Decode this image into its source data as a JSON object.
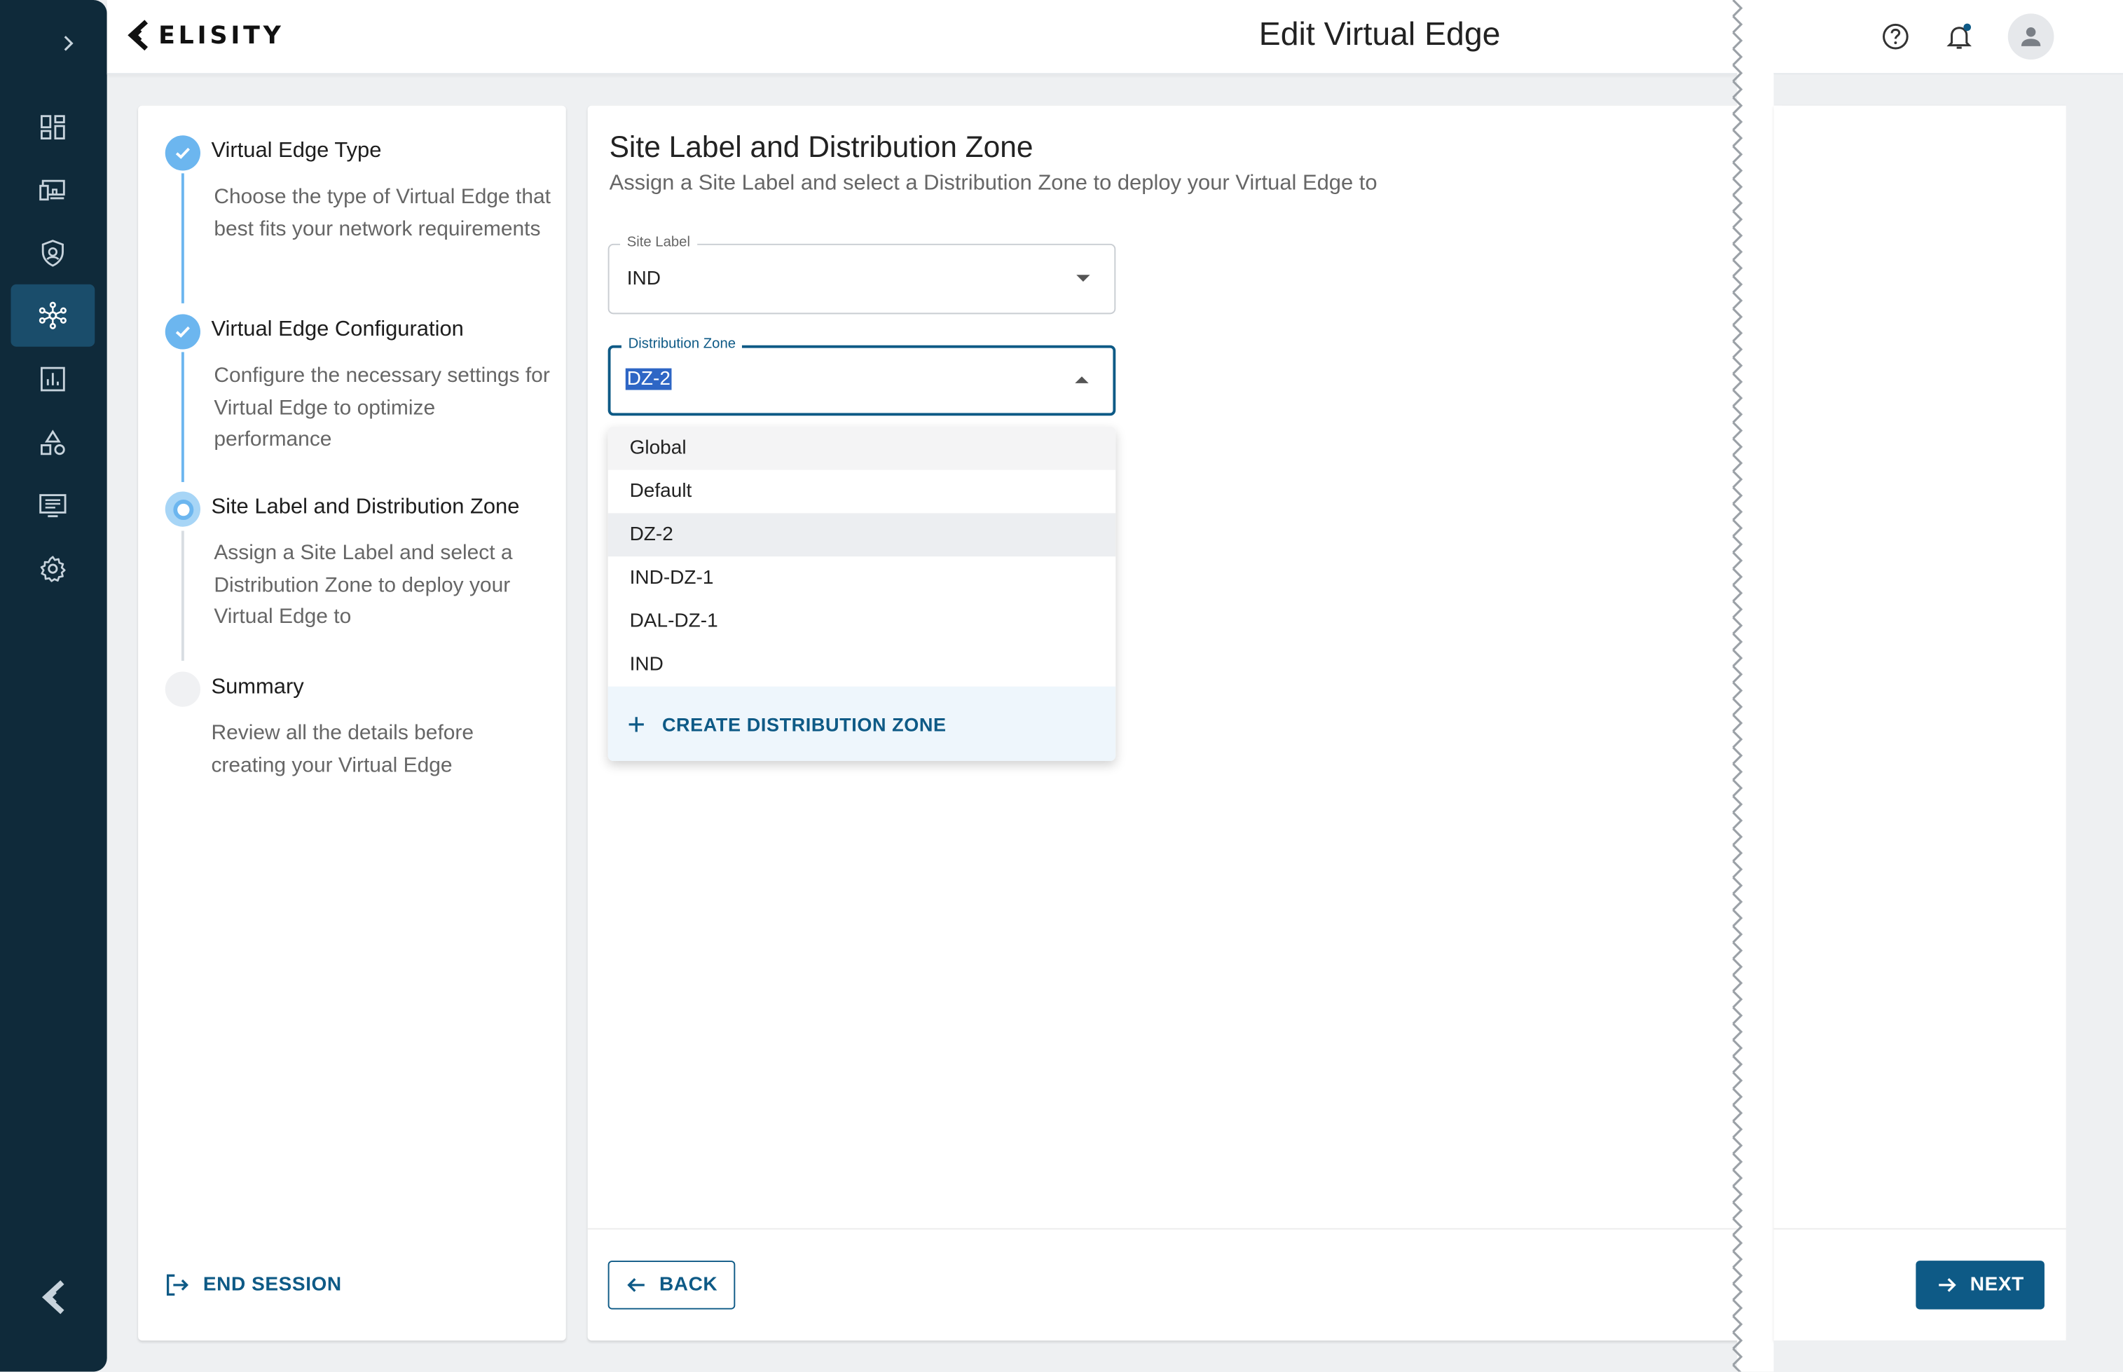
{
  "header": {
    "logo_text": "ELISITY",
    "title": "Edit Virtual Edge",
    "icons": [
      "help-icon",
      "bell-icon",
      "user-avatar-icon"
    ],
    "notification_dot_color": "#0e5a86"
  },
  "nav": {
    "expand_icon": "chevron-right-icon",
    "items": [
      {
        "name": "dashboard-icon",
        "active": false
      },
      {
        "name": "devices-icon",
        "active": false
      },
      {
        "name": "policy-shield-icon",
        "active": false
      },
      {
        "name": "network-icon",
        "active": true
      },
      {
        "name": "analytics-icon",
        "active": false
      },
      {
        "name": "shapes-icon",
        "active": false
      },
      {
        "name": "monitor-list-icon",
        "active": false
      },
      {
        "name": "settings-gear-icon",
        "active": false
      }
    ],
    "bottom_logo": "elisity-mark-icon"
  },
  "stepper": {
    "steps": [
      {
        "title": "Virtual Edge Type",
        "description": "Choose the type of Virtual Edge that best fits your network requirements",
        "state": "done"
      },
      {
        "title": "Virtual Edge Configuration",
        "description": "Configure the necessary settings for Virtual Edge to optimize performance",
        "state": "done"
      },
      {
        "title": "Site Label and Distribution Zone",
        "description": "Assign a Site Label and select a Distribution Zone to deploy your Virtual Edge to",
        "state": "current"
      },
      {
        "title": "Summary",
        "description": "Review all the details before creating your Virtual Edge",
        "state": "todo"
      }
    ],
    "end_session_label": "END SESSION"
  },
  "main": {
    "title": "Site Label and Distribution Zone",
    "subtitle": "Assign a Site Label and select a Distribution Zone to deploy your Virtual Edge to",
    "site_label": {
      "label": "Site Label",
      "value": "IND"
    },
    "distribution_zone": {
      "label": "Distribution Zone",
      "value": "DZ-2"
    },
    "dropdown_options": [
      "Global",
      "Default",
      "DZ-2",
      "IND-DZ-1",
      "DAL-DZ-1",
      "IND"
    ],
    "create_zone_label": "CREATE DISTRIBUTION ZONE",
    "back_label": "BACK",
    "next_label": "NEXT"
  },
  "colors": {
    "primary": "#0e5a86",
    "nav_bg": "#0f2a3a",
    "nav_active": "#1a4d6b",
    "step_accent": "#6cb6ef"
  }
}
